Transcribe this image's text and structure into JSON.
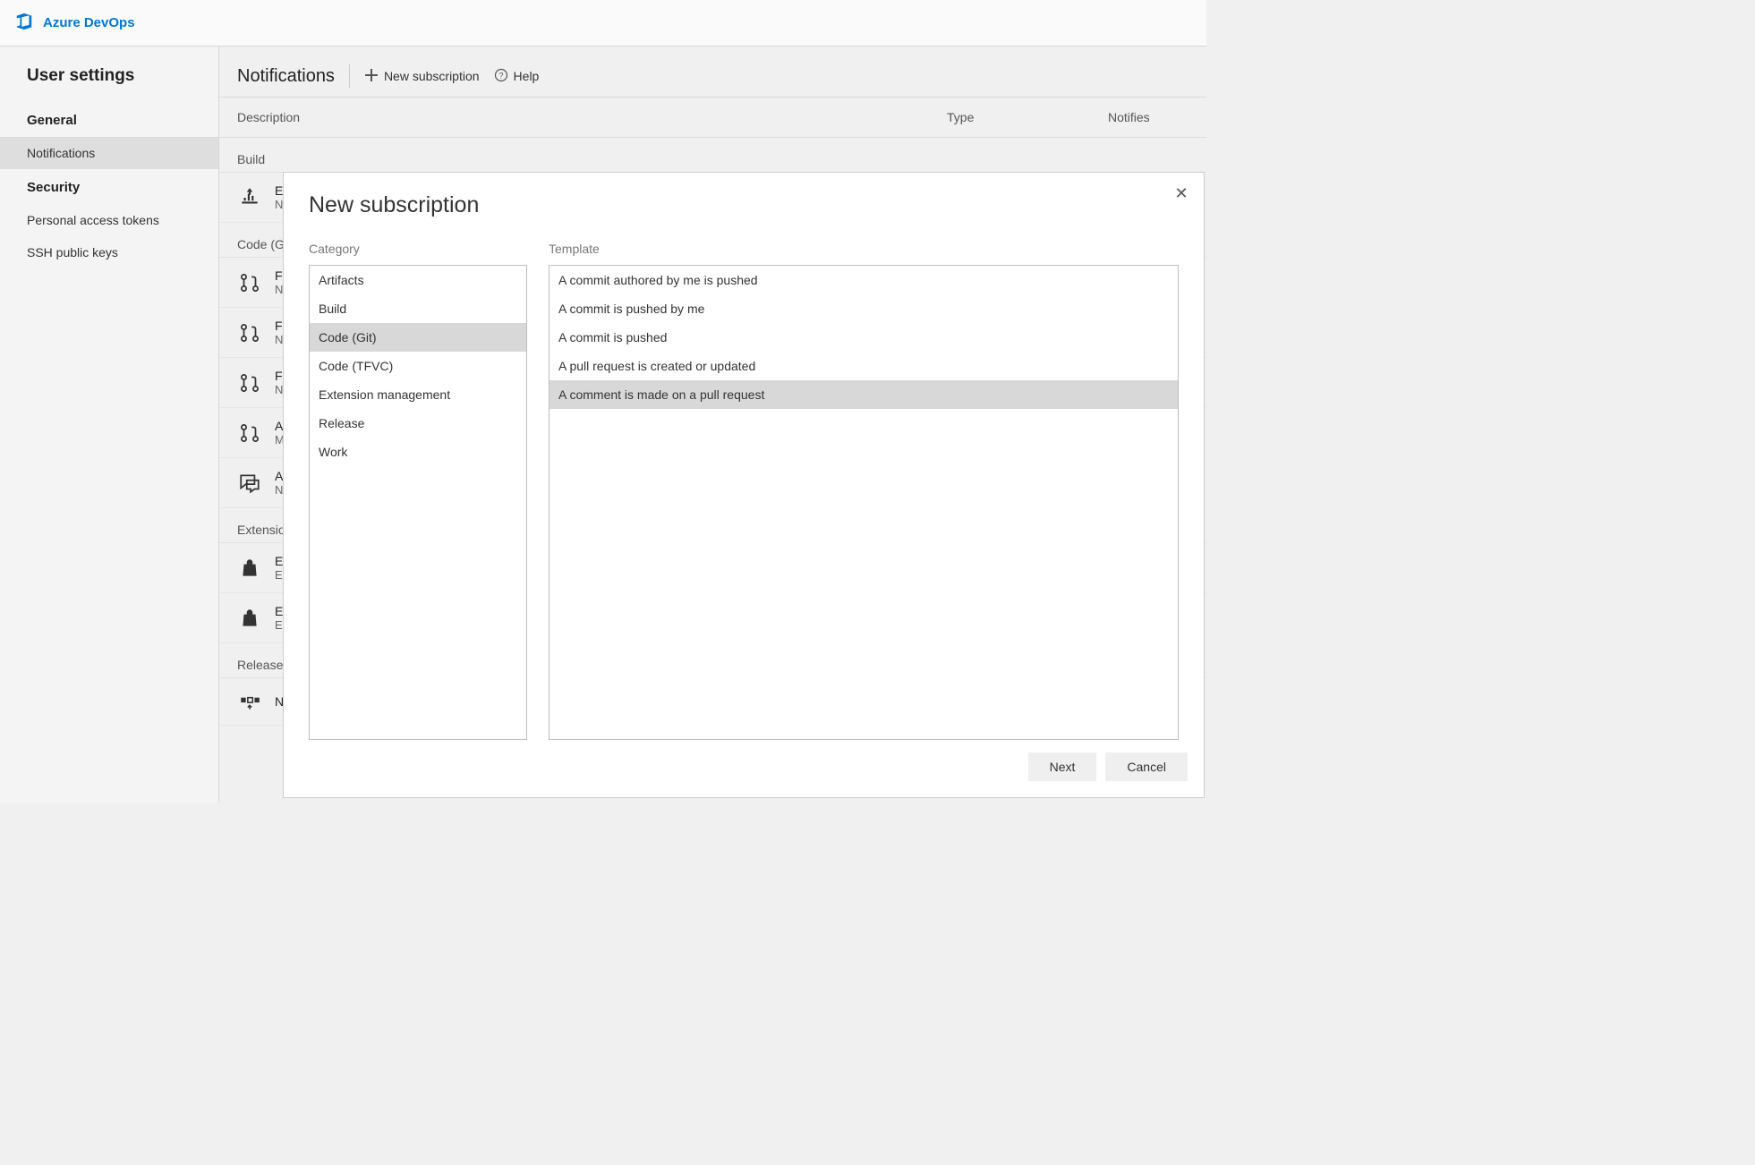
{
  "brand": "Azure DevOps",
  "sidebar": {
    "title": "User settings",
    "groups": [
      {
        "heading": "General",
        "items": [
          {
            "label": "Notifications",
            "active": true
          }
        ]
      },
      {
        "heading": "Security",
        "items": [
          {
            "label": "Personal access tokens",
            "active": false
          },
          {
            "label": "SSH public keys",
            "active": false
          }
        ]
      }
    ]
  },
  "page": {
    "title": "Notifications",
    "new_sub_label": "New subscription",
    "help_label": "Help",
    "cols": {
      "description": "Description",
      "type": "Type",
      "notifies": "Notifies"
    }
  },
  "sections": [
    {
      "label": "Build",
      "rows": [
        {
          "icon": "build",
          "title": "E",
          "sub": "N"
        }
      ]
    },
    {
      "label": "Code (G",
      "rows": [
        {
          "icon": "pr",
          "title": "F",
          "sub": "N"
        },
        {
          "icon": "pr",
          "title": "F",
          "sub": "N"
        },
        {
          "icon": "pr",
          "title": "F",
          "sub": "N"
        },
        {
          "icon": "pr",
          "title": "A",
          "sub": "M"
        },
        {
          "icon": "chat",
          "title": "A",
          "sub": "N"
        }
      ]
    },
    {
      "label": "Extensio",
      "rows": [
        {
          "icon": "bag",
          "title": "E",
          "sub": "E"
        },
        {
          "icon": "bag",
          "title": "E",
          "sub": "E"
        }
      ]
    },
    {
      "label": "Release",
      "rows": [
        {
          "icon": "release",
          "title": "N",
          "sub": ""
        }
      ]
    }
  ],
  "modal": {
    "title": "New subscription",
    "category_label": "Category",
    "template_label": "Template",
    "categories": [
      {
        "label": "Artifacts",
        "selected": false
      },
      {
        "label": "Build",
        "selected": false
      },
      {
        "label": "Code (Git)",
        "selected": true
      },
      {
        "label": "Code (TFVC)",
        "selected": false
      },
      {
        "label": "Extension management",
        "selected": false
      },
      {
        "label": "Release",
        "selected": false
      },
      {
        "label": "Work",
        "selected": false
      }
    ],
    "templates": [
      {
        "label": "A commit authored by me is pushed",
        "selected": false
      },
      {
        "label": "A commit is pushed by me",
        "selected": false
      },
      {
        "label": "A commit is pushed",
        "selected": false
      },
      {
        "label": "A pull request is created or updated",
        "selected": false
      },
      {
        "label": "A comment is made on a pull request",
        "selected": true
      }
    ],
    "next_label": "Next",
    "cancel_label": "Cancel"
  }
}
